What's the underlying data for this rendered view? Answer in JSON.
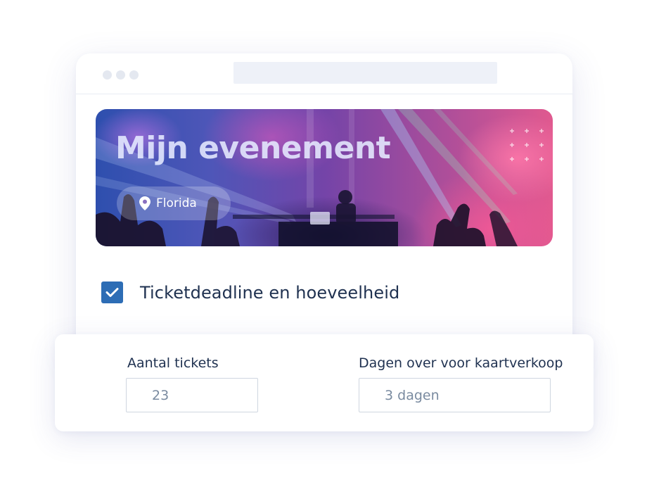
{
  "banner": {
    "title": "Mijn evenement",
    "location": "Florida"
  },
  "checkbox": {
    "label": "Ticketdeadline en hoeveelheid",
    "checked": true
  },
  "form": {
    "tickets": {
      "label": "Aantal tickets",
      "value": "23"
    },
    "days": {
      "label": "Dagen over voor kaartverkoop",
      "value": "3 dagen"
    }
  },
  "icons": {
    "location": "location-pin-icon",
    "check": "checkmark-icon"
  },
  "colors": {
    "accent": "#2d6db5",
    "text": "#1f3150",
    "input_text": "#7a8ba0"
  }
}
